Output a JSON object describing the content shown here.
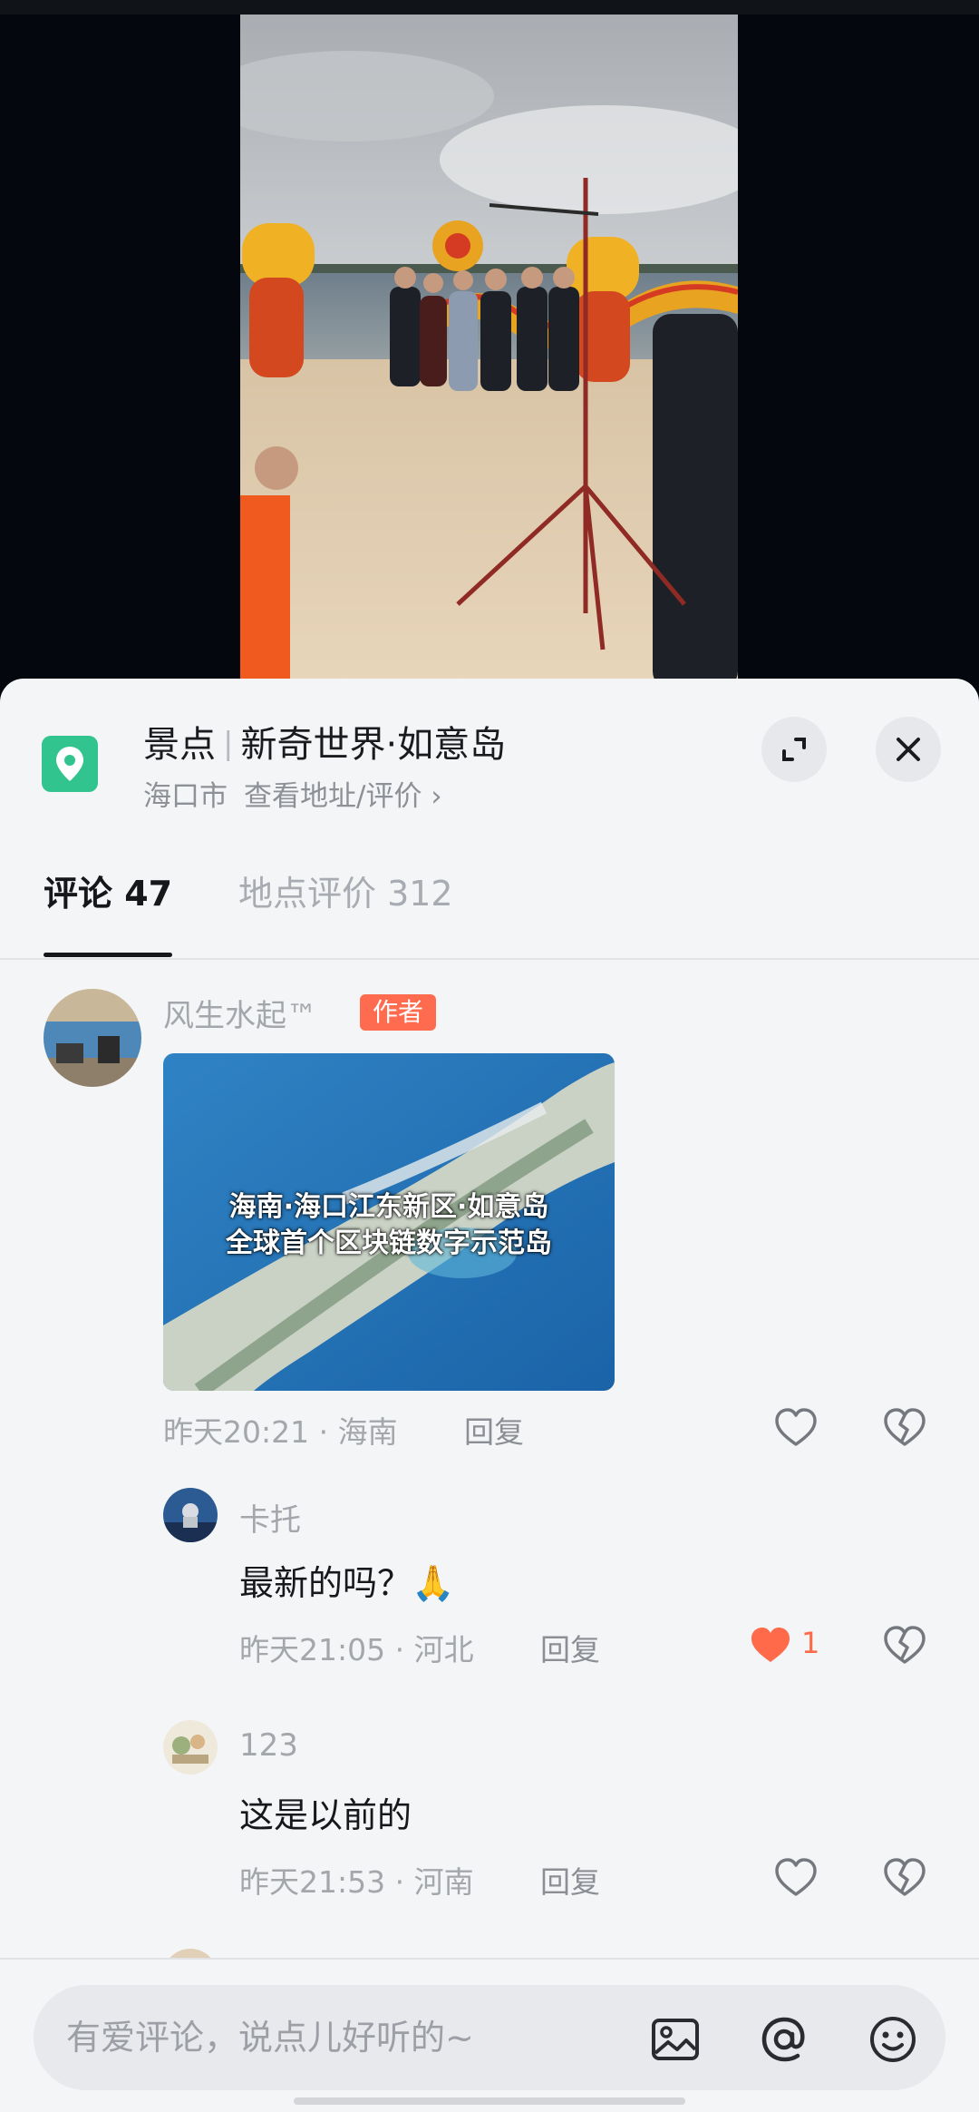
{
  "location": {
    "category": "景点",
    "name": "新奇世界·如意岛",
    "city": "海口市",
    "detail_link": "查看地址/评价 ›"
  },
  "tabs": [
    {
      "label": "评论 47"
    },
    {
      "label": "地点评价 312"
    }
  ],
  "comments": [
    {
      "username": "风生水起™",
      "badge": "作者",
      "image_caption_line1": "海南·海口江东新区·如意岛",
      "image_caption_line2": "全球首个区块链数字示范岛",
      "time_region": "昨天20:21 · 海南",
      "reply_label": "回复"
    },
    {
      "username": "卡托",
      "text": "最新的吗？🙏",
      "time_region": "昨天21:05 · 河北",
      "reply_label": "回复",
      "likes": "1"
    },
    {
      "username": "123",
      "text": "这是以前的",
      "time_region": "昨天21:53 · 河南",
      "reply_label": "回复"
    }
  ],
  "input": {
    "placeholder": "有爱评论，说点儿好听的~"
  },
  "colors": {
    "accent_location": "#31c48f",
    "author_badge": "#fe6b4f",
    "liked_heart": "#ff6a4a",
    "sheet_background": "#f4f5f7"
  },
  "icons": {
    "location": "map-pin-icon",
    "expand": "expand-icon",
    "close": "close-icon",
    "like": "heart-outline-icon",
    "liked": "heart-filled-icon",
    "dislike": "broken-heart-icon",
    "image": "image-icon",
    "mention": "at-icon",
    "emoji": "smiley-icon"
  }
}
